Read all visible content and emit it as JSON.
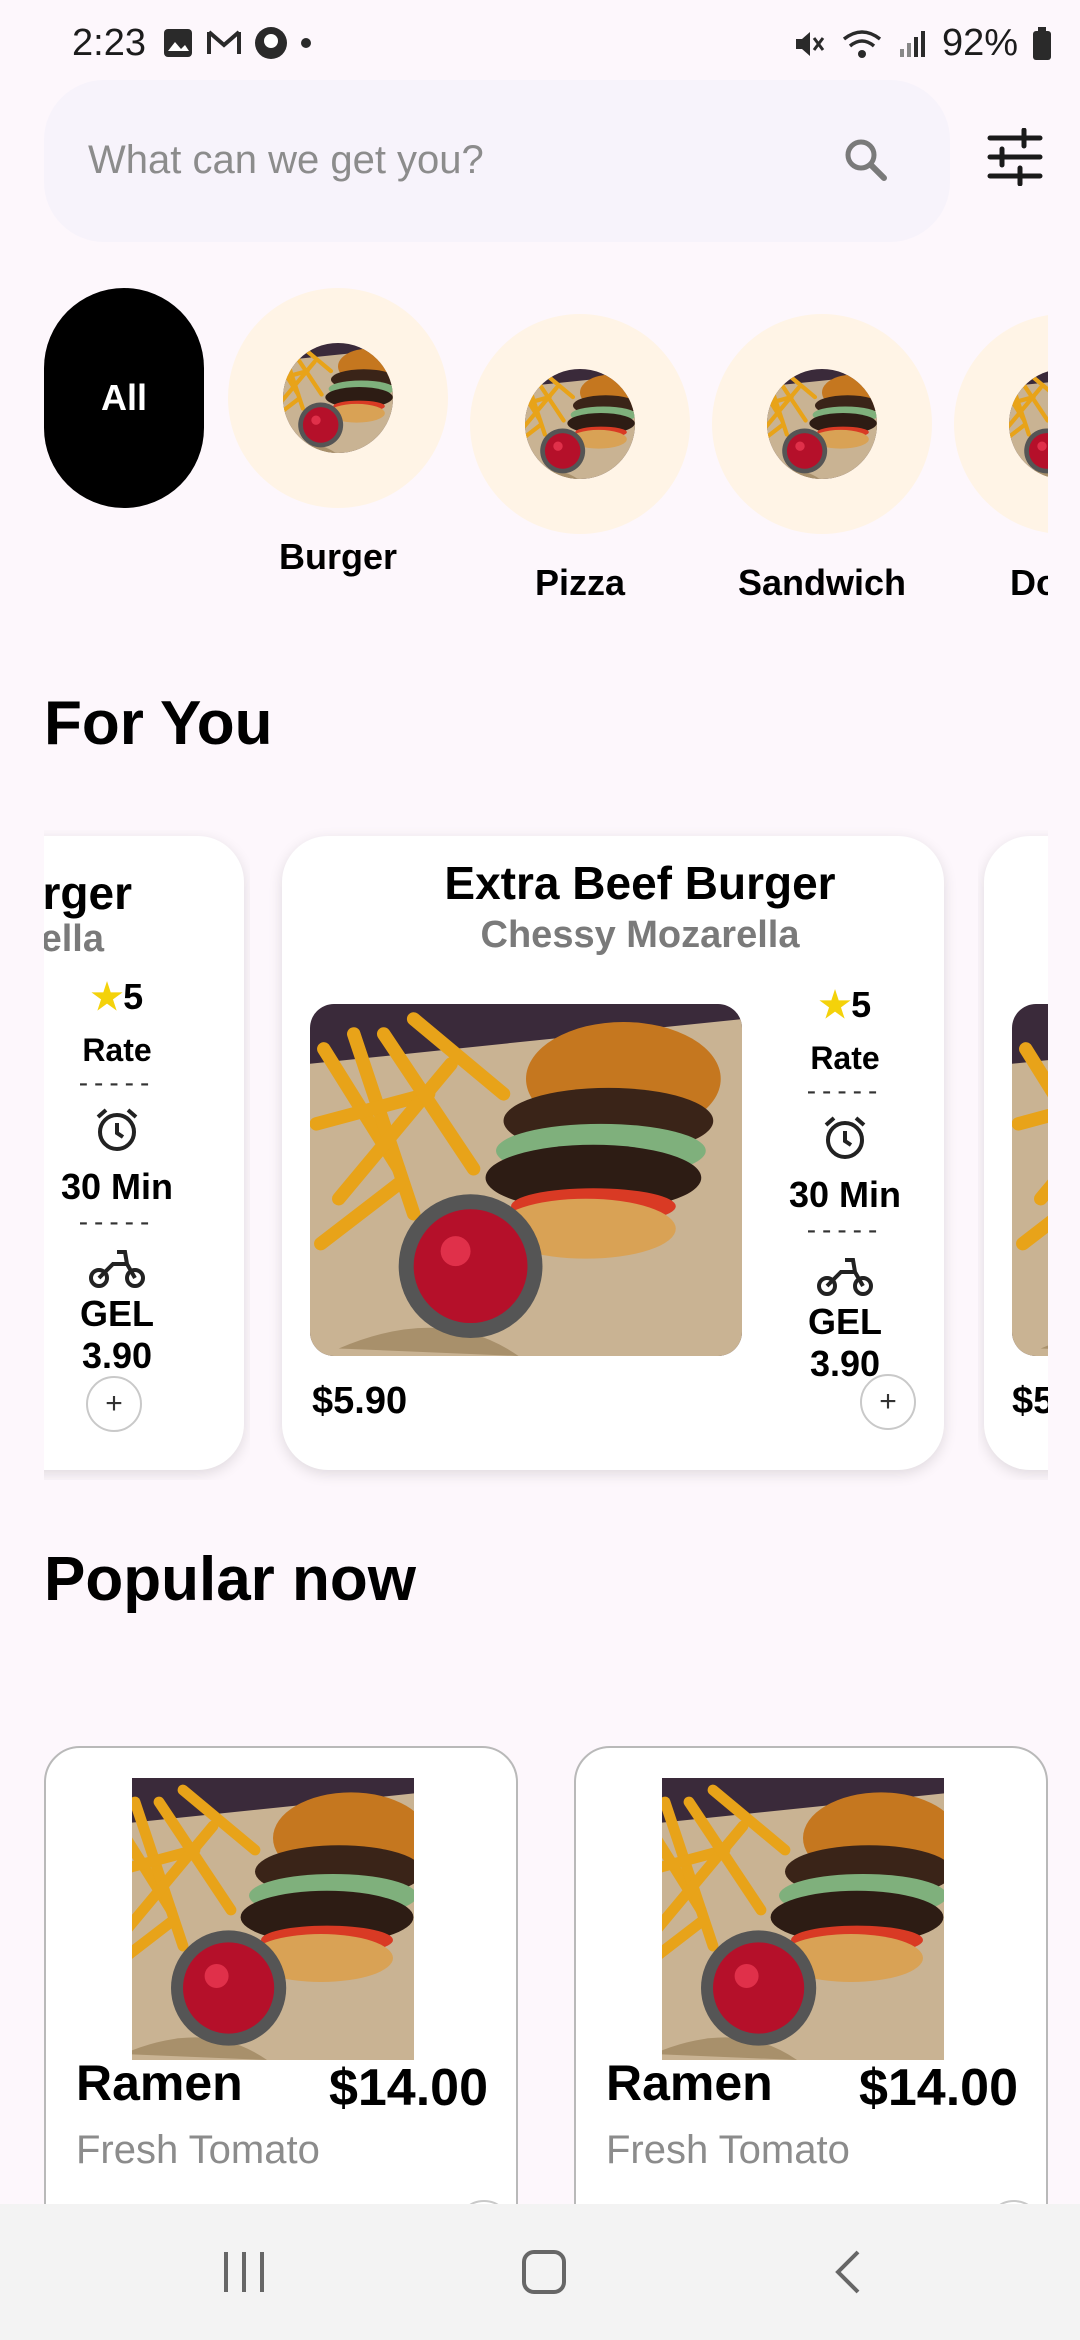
{
  "status_bar": {
    "time": "2:23",
    "battery": "92%"
  },
  "search": {
    "placeholder": "What can we get you?",
    "icon": "search-icon",
    "filter_icon": "sliders-icon"
  },
  "categories": [
    {
      "label": "All",
      "selected": true
    },
    {
      "label": "Burger"
    },
    {
      "label": "Pizza"
    },
    {
      "label": "Sandwich"
    },
    {
      "label": "Do"
    }
  ],
  "for_you": {
    "title": "For You",
    "left_card": {
      "title_fragment": "rger",
      "sub_fragment": "ella",
      "rating": "5",
      "rate_label": "Rate",
      "time": "30 Min",
      "delivery": "GEL 3.90"
    },
    "main_card": {
      "title": "Extra Beef Burger",
      "subtitle": "Chessy Mozarella",
      "price": "$5.90",
      "rating": "5",
      "rate_label": "Rate",
      "time": "30 Min",
      "delivery": "GEL 3.90"
    },
    "right_card": {
      "price_fragment": "$5"
    },
    "separator": "-----"
  },
  "popular": {
    "title": "Popular now",
    "items": [
      {
        "name": "Ramen",
        "price": "$14.00",
        "subtitle": "Fresh Tomato"
      },
      {
        "name": "Ramen",
        "price": "$14.00",
        "subtitle": "Fresh Tomato"
      }
    ]
  },
  "colors": {
    "accent_star": "#f4d20a",
    "category_bg": "#fff4e6",
    "page_bg": "#fdf7fc"
  }
}
